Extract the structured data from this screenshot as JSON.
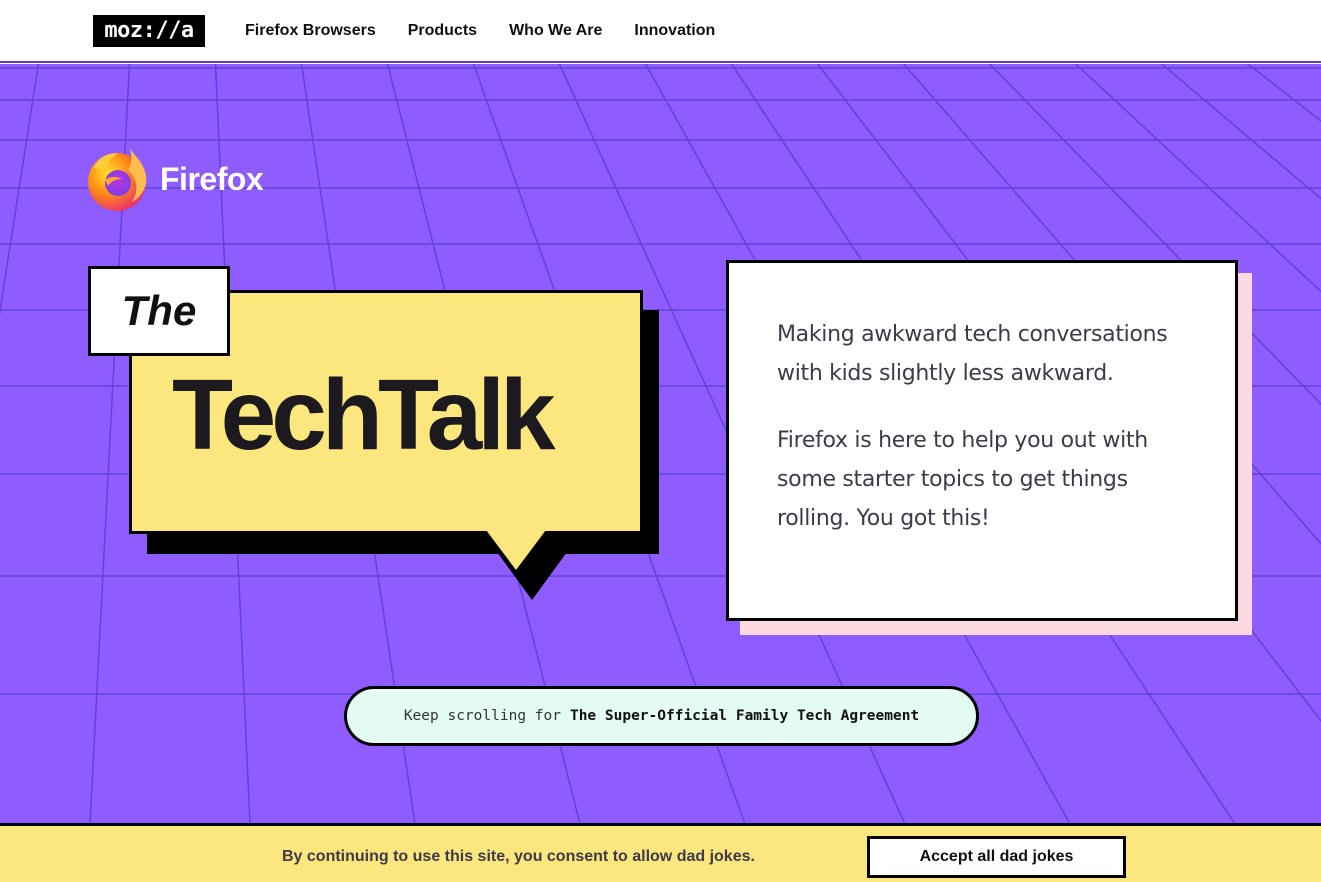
{
  "header": {
    "logo": "moz://a",
    "nav": [
      "Firefox Browsers",
      "Products",
      "Who We Are",
      "Innovation"
    ]
  },
  "hero": {
    "brand": "Firefox",
    "title_small": "The",
    "title_big": "TechTalk",
    "intro": [
      "Making awkward tech conversations with kids slightly less awkward.",
      "Firefox is here to help you out with some starter topics to get things rolling. You got this!"
    ],
    "scroll_prefix": "Keep scrolling for",
    "scroll_strong": "The Super-Official Family Tech Agreement"
  },
  "cookie": {
    "text": "By continuing to use this site, you consent to allow dad jokes.",
    "button": "Accept all dad jokes"
  },
  "colors": {
    "hero_bg": "#8f5cff",
    "grid_line": "#5a3fd0",
    "bubble": "#fce67e",
    "card_shadow": "#fcd8e0",
    "pill_bg": "#e4fbf1"
  },
  "icons": [
    "firefox-logo-icon"
  ]
}
